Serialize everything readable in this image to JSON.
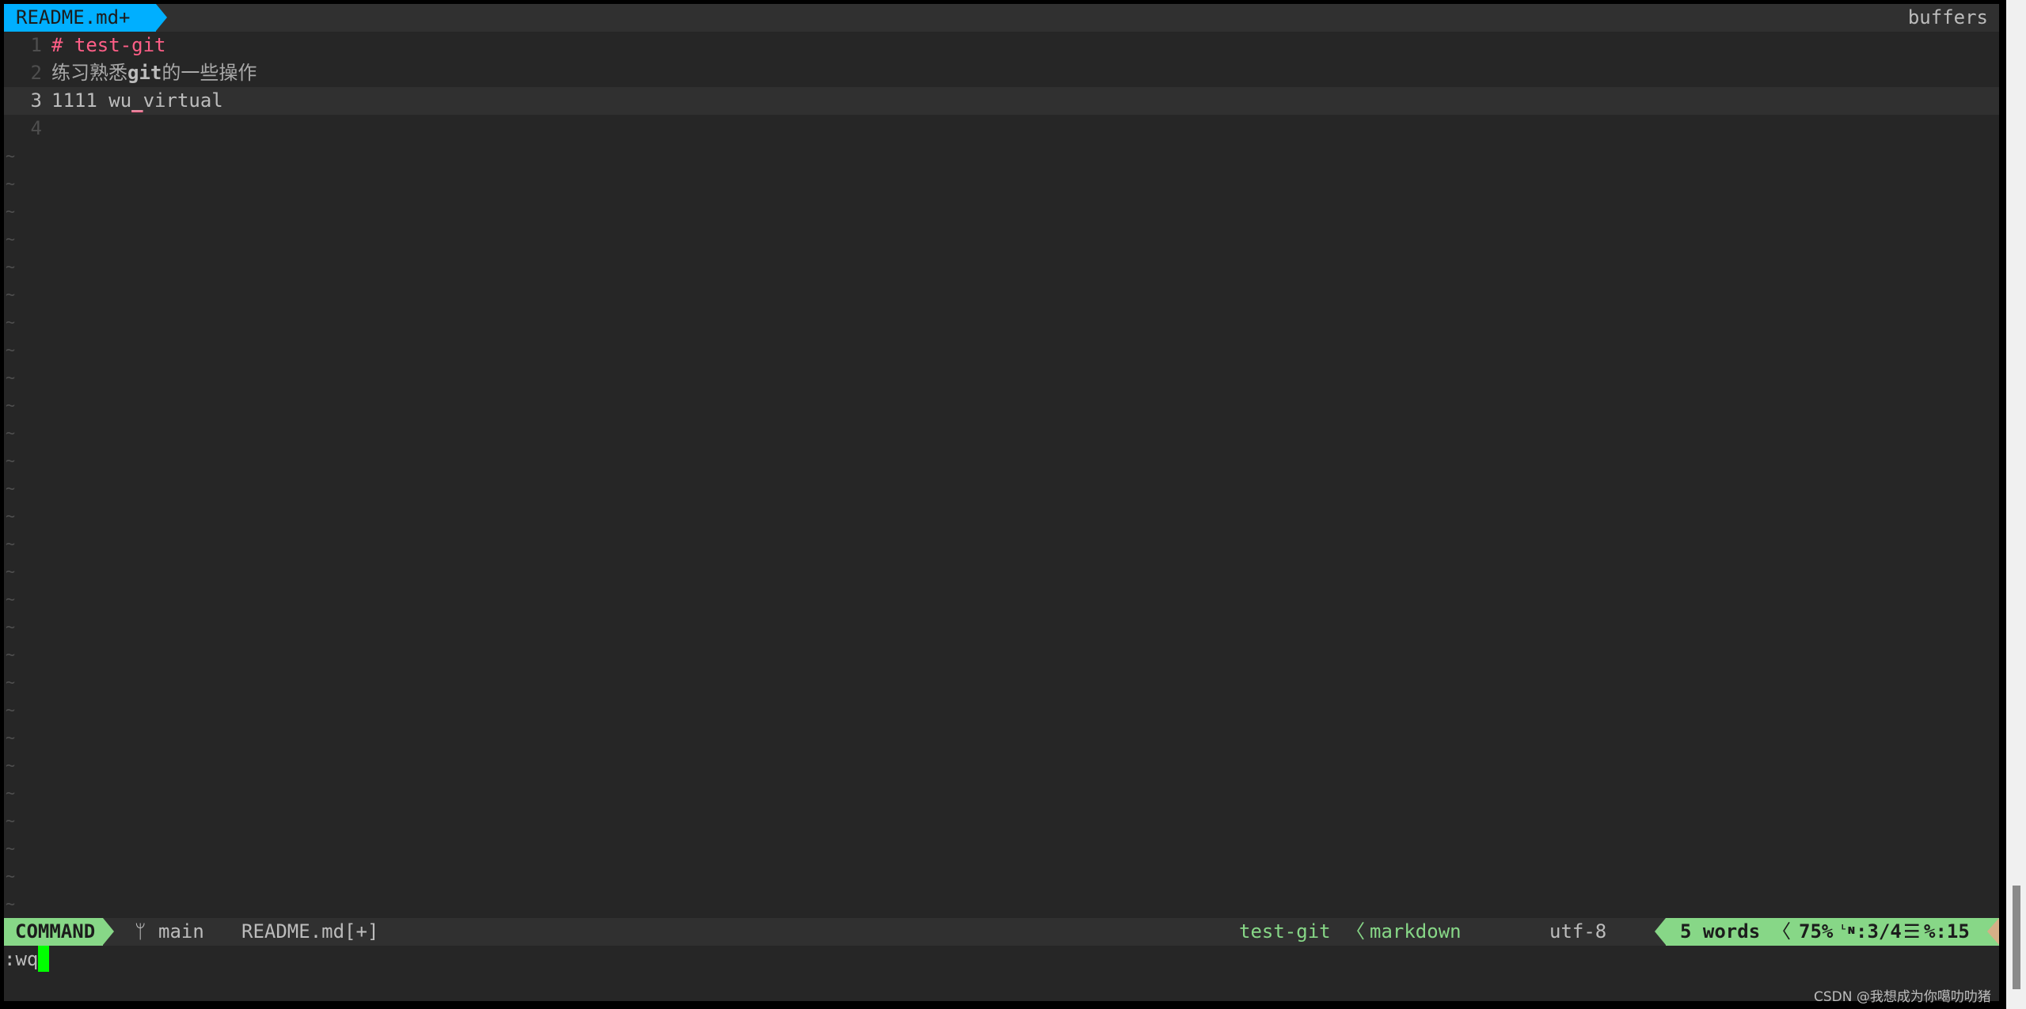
{
  "tabline": {
    "active_tab": "README.md+",
    "right_label": "buffers"
  },
  "buffer": {
    "lines": [
      {
        "number": "1",
        "segments": [
          {
            "text": "# test-git",
            "style": "heading"
          }
        ]
      },
      {
        "number": "2",
        "segments": [
          {
            "text": "练习熟悉",
            "style": "cjk"
          },
          {
            "text": "git",
            "style": "bold"
          },
          {
            "text": "的一些操作",
            "style": "cjk"
          }
        ]
      },
      {
        "number": "3",
        "segments": [
          {
            "text": "1111 wu",
            "style": "normal"
          },
          {
            "text": "_",
            "style": "emph"
          },
          {
            "text": "virtual",
            "style": "normal"
          }
        ],
        "cursorline": true
      },
      {
        "number": "4",
        "segments": []
      }
    ],
    "tilde_char": "~",
    "tilde_count": 28
  },
  "statusline": {
    "mode": "COMMAND",
    "branch_icon": "git-branch-icon",
    "branch_glyph": "ᛘ",
    "branch": "main",
    "filename": "README.md[+]",
    "project": "test-git",
    "separator": "〈",
    "filetype": "markdown",
    "encoding": "utf-8",
    "word_count": "5 words",
    "percent": "75%",
    "line_icon_glyph": "ᴸɴ",
    "line_pos": ":3/4",
    "col_icon_glyph": "☰",
    "col_pos": "%:15",
    "colors": {
      "mode_bg": "#87d787",
      "tab_bg": "#00afff",
      "end_accent": "#d7af87"
    }
  },
  "cmdline": {
    "text": ":wq"
  },
  "watermark": "CSDN @我想成为你噶叻叻猪"
}
